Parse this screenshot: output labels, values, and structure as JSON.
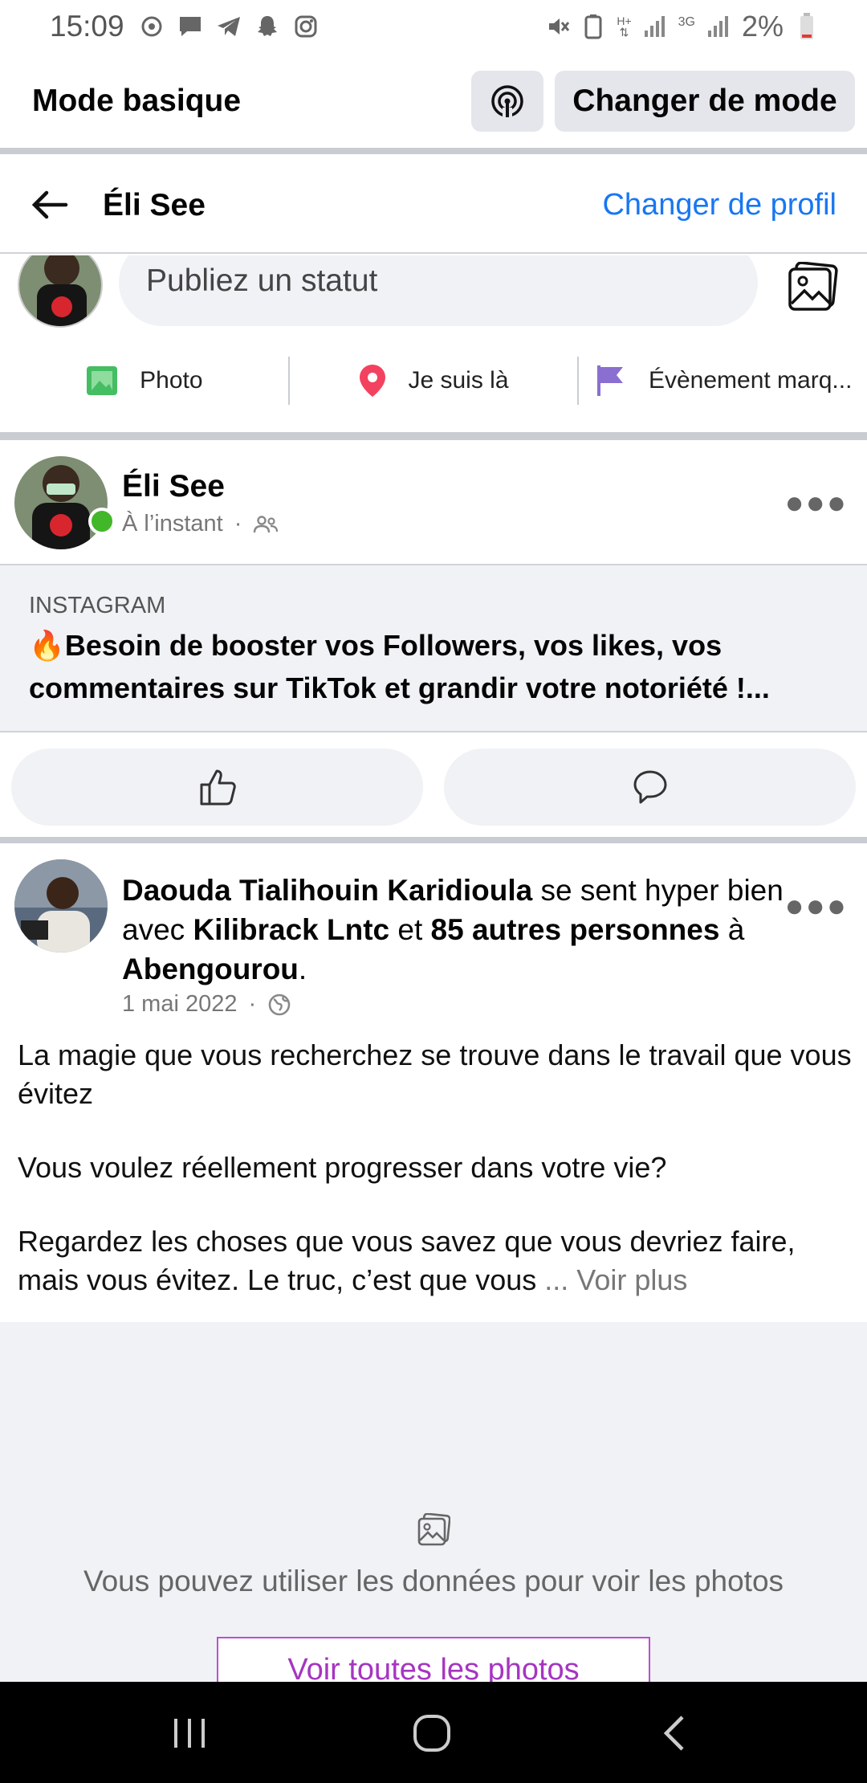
{
  "status_bar": {
    "time": "15:09",
    "battery": "2%",
    "network_labels": [
      "H+",
      "3G"
    ],
    "left_icons": [
      "sync-icon",
      "message-icon",
      "telegram-icon",
      "snapchat-icon",
      "instagram-icon"
    ],
    "right_icons": [
      "mute-icon",
      "battery-saver-icon",
      "data-arrows-icon",
      "signal-icon",
      "signal-icon",
      "battery-icon"
    ]
  },
  "mode_bar": {
    "title": "Mode basique",
    "data_icon": "broadcast-icon",
    "switch_label": "Changer de mode"
  },
  "profile_header": {
    "back_icon": "back-arrow-icon",
    "name": "Éli See",
    "switch_profile": "Changer de profil"
  },
  "composer": {
    "placeholder": "Publiez un statut",
    "actions": [
      {
        "label": "Photo",
        "icon": "photo-icon",
        "color": "#45bd62"
      },
      {
        "label": "Je suis là",
        "icon": "location-pin-icon",
        "color": "#f3425f"
      },
      {
        "label": "Évènement marq...",
        "icon": "flag-icon",
        "color": "#8a6fd0"
      }
    ]
  },
  "post1": {
    "author": "Éli See",
    "time": "À l’instant",
    "audience_icon": "friends-icon",
    "link": {
      "source": "INSTAGRAM",
      "emoji": "🔥",
      "title": "Besoin de booster vos Followers, vos likes, vos commentaires sur TikTok et grandir votre notoriété !..."
    }
  },
  "post2": {
    "author": "Daouda Tialihouin Karidioula",
    "feeling": " se sent hyper bien avec ",
    "tag1": "Kilibrack Lntc",
    "and": " et ",
    "tag2": "85 autres personnes",
    "at": " à ",
    "place": "Abengourou",
    "period": ".",
    "date": "1 mai 2022",
    "audience_icon": "globe-icon",
    "para1": "La magie que vous recherchez se trouve dans le travail que vous évitez",
    "para2": "Vous voulez réellement progresser dans votre vie?",
    "para3": "Regardez les choses que vous savez que vous devriez faire, mais vous évitez. Le truc, c’est que vous ",
    "see_more": "... Voir plus"
  },
  "photo_notice": {
    "text": "Vous pouvez utiliser les données pour voir les photos",
    "button": "Voir toutes les photos"
  },
  "colors": {
    "accent": "#1877f2",
    "online": "#42b72a",
    "button_bg": "#e4e6eb",
    "purple_button": "#a635c1"
  }
}
